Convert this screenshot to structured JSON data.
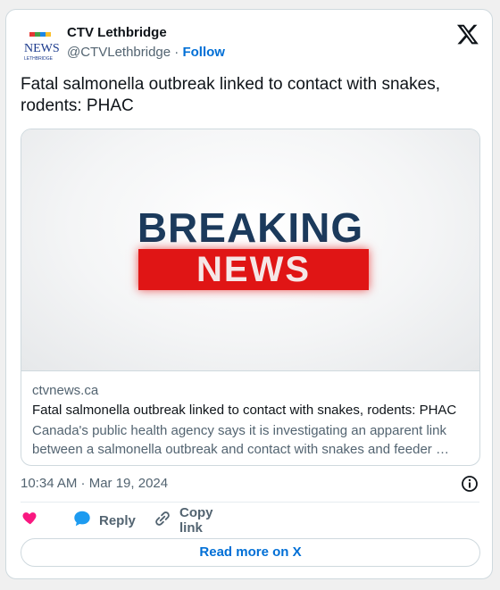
{
  "author": {
    "name": "CTV Lethbridge",
    "handle": "@CTVLethbridge",
    "separator": "·",
    "follow_label": "Follow",
    "logo_top": "NEWS",
    "logo_bottom": "LETHBRIDGE",
    "logo_icon": "ctv-news-lethbridge-logo"
  },
  "platform_icon": "x-logo-icon",
  "tweet": {
    "text": "Fatal salmonella outbreak linked to contact with snakes, rodents: PHAC"
  },
  "link_card": {
    "image_line1": "BREAKING",
    "image_line2": "NEWS",
    "domain": "ctvnews.ca",
    "title": "Fatal salmonella outbreak linked to contact with snakes, rodents: PHAC",
    "description": "Canada's public health agency says it is investigating an apparent link between a salmonella outbreak and contact with snakes and feeder …"
  },
  "timestamp": "10:34 AM · Mar 19, 2024",
  "actions": {
    "like_icon": "heart-icon",
    "reply_label": "Reply",
    "copy_link_label": "Copy link"
  },
  "read_more_label": "Read more on X",
  "colors": {
    "link_blue": "#006fd6",
    "heart_pink": "#f91880",
    "reply_blue": "#1d9bf0",
    "breaking_navy": "#1b3a5c",
    "news_red": "#e01515"
  }
}
